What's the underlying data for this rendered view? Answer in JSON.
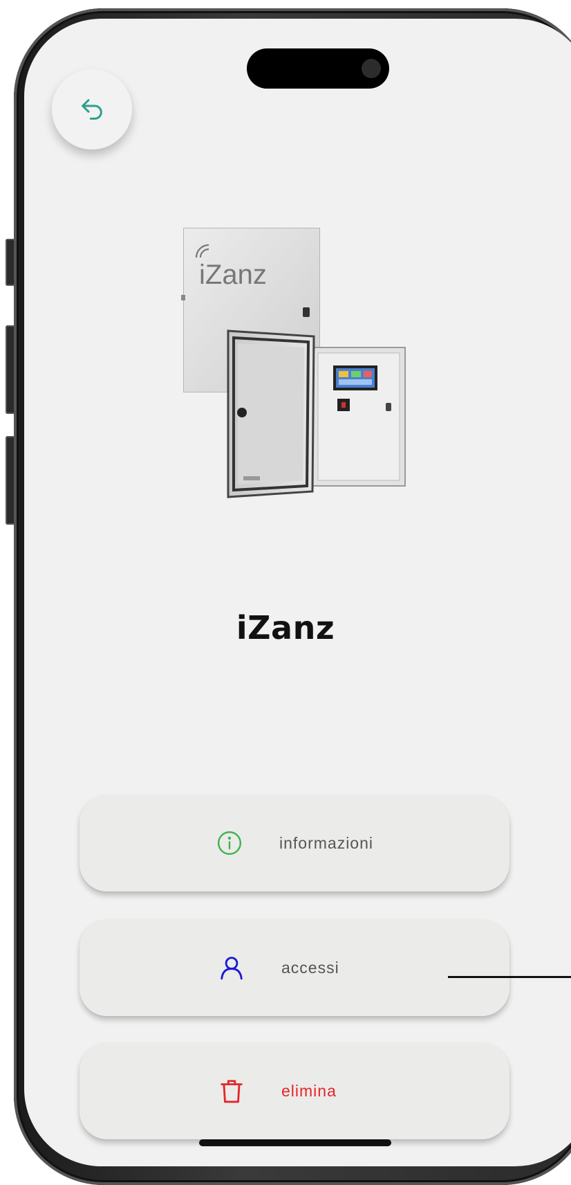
{
  "device": {
    "title": "iZanz"
  },
  "product_image": {
    "logo_text": "iZanz"
  },
  "actions": [
    {
      "label": "informazioni",
      "icon": "info-icon",
      "color": "#3ab34a"
    },
    {
      "label": "accessi",
      "icon": "user-icon",
      "color": "#1a1ad6"
    },
    {
      "label": "elimina",
      "icon": "trash-icon",
      "color": "#e3262b"
    }
  ],
  "colors": {
    "back_icon": "#2e9e8a",
    "label_text": "#555555",
    "delete_text": "#e3262b",
    "background": "#f1f1f1"
  }
}
